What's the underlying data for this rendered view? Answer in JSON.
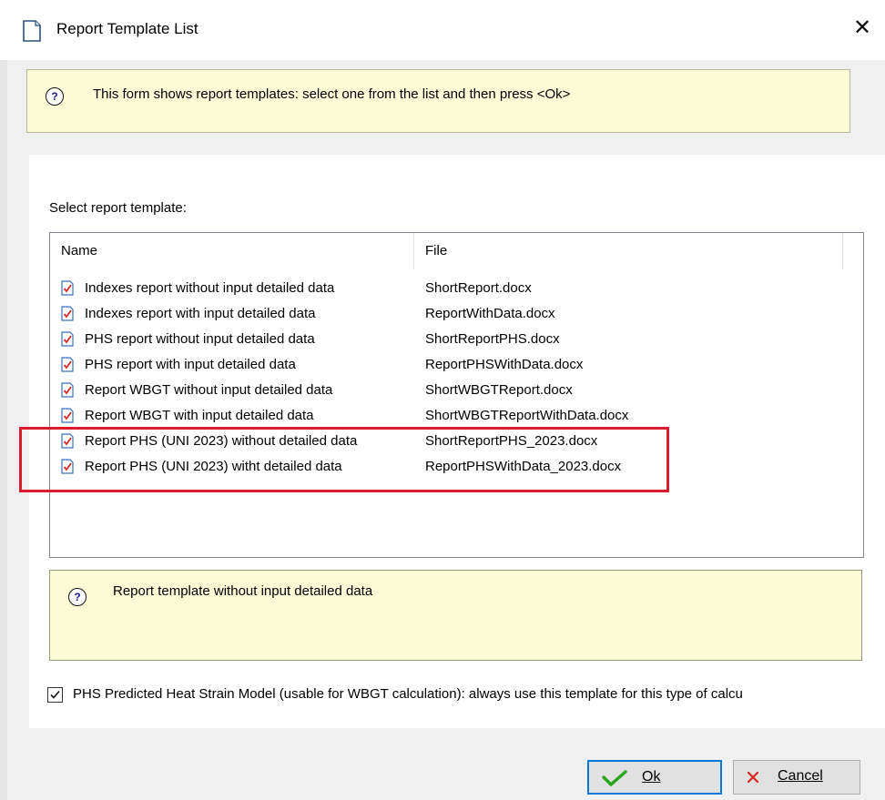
{
  "window": {
    "title": "Report Template List",
    "close_glyph": "✕",
    "icon": "document-icon"
  },
  "info_top": {
    "text": "This form shows report templates: select one from the list and then press <Ok>",
    "icon": "question-icon",
    "icon_glyph": "?"
  },
  "select_label": "Select report template:",
  "listview": {
    "columns": [
      "Name",
      "File"
    ],
    "row_icon": "word-document-icon",
    "rows": [
      {
        "name": "Indexes report without input detailed data",
        "file": "ShortReport.docx"
      },
      {
        "name": "Indexes report with input detailed data",
        "file": "ReportWithData.docx"
      },
      {
        "name": "PHS report without input detailed data",
        "file": "ShortReportPHS.docx"
      },
      {
        "name": "PHS report with input detailed data",
        "file": "ReportPHSWithData.docx"
      },
      {
        "name": "Report WBGT without input detailed data",
        "file": "ShortWBGTReport.docx"
      },
      {
        "name": "Report WBGT with input detailed data",
        "file": "ShortWBGTReportWithData.docx"
      },
      {
        "name": "Report PHS (UNI 2023) without detailed data",
        "file": "ShortReportPHS_2023.docx"
      },
      {
        "name": "Report PHS (UNI 2023) witht detailed data",
        "file": "ReportPHSWithData_2023.docx"
      }
    ],
    "highlight_color": "#dc1c2c"
  },
  "description": {
    "text": "Report template without input detailed data",
    "icon": "question-icon",
    "icon_glyph": "?"
  },
  "checkbox": {
    "checked": true,
    "label": "PHS Predicted Heat Strain Model (usable for WBGT calculation): always use this template for this type of calcu"
  },
  "buttons": {
    "ok": {
      "label": "Ok",
      "icon": "green-check-icon"
    },
    "cancel": {
      "label": "Cancel",
      "icon": "red-x-icon"
    }
  },
  "colors": {
    "info_background": "#fbfbd6",
    "focus_border": "#0078d7"
  }
}
